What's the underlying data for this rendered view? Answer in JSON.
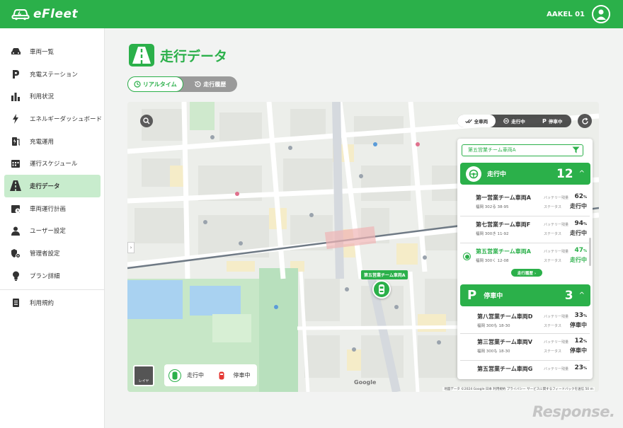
{
  "header": {
    "app_name": "eFleet",
    "user_name": "AAKEL 01",
    "brand_color": "#2bb04a"
  },
  "sidebar": {
    "items": [
      {
        "label": "車両一覧",
        "icon": "car-icon"
      },
      {
        "label": "充電ステーション",
        "icon": "parking-icon"
      },
      {
        "label": "利用状況",
        "icon": "bar-chart-icon"
      },
      {
        "label": "エネルギーダッシュボード",
        "icon": "lightning-icon"
      },
      {
        "label": "充電運用",
        "icon": "charger-icon"
      },
      {
        "label": "運行スケジュール",
        "icon": "calendar-icon"
      },
      {
        "label": "走行データ",
        "icon": "road-icon",
        "active": true
      },
      {
        "label": "車両運行計画",
        "icon": "calendar-plan-icon"
      },
      {
        "label": "ユーザー設定",
        "icon": "user-icon"
      },
      {
        "label": "管理者設定",
        "icon": "admin-settings-icon"
      },
      {
        "label": "プラン詳細",
        "icon": "bulb-icon"
      },
      {
        "label": "利用規約",
        "icon": "document-icon"
      }
    ]
  },
  "page": {
    "title": "走行データ",
    "toggle": {
      "realtime": "リアルタイム",
      "history": "走行履歴"
    }
  },
  "map": {
    "filters": {
      "all": "全車両",
      "driving": "走行中",
      "parked": "停車中"
    },
    "legend": {
      "driving": "走行中",
      "parked": "停車中",
      "layer": "レイヤ"
    },
    "pin_label": "第五営業チーム車両A",
    "google": "Google",
    "attribution": "地図データ ©2024 Google  日本  利用規約  プライバシー  サービスに関するフィードバックを送信  50 m"
  },
  "panel": {
    "search_value": "第五営業チーム車両A",
    "driving": {
      "label": "走行中",
      "count": "12",
      "vehicles": [
        {
          "name": "第一営業チーム車両A",
          "plate": "福岡 302る 38-95",
          "battery_label": "バッテリー残量",
          "battery": "62",
          "status_label": "ステータス",
          "status": "走行中"
        },
        {
          "name": "第七営業チーム車両F",
          "plate": "福岡 300き 11-92",
          "battery_label": "バッテリー残量",
          "battery": "94",
          "status_label": "ステータス",
          "status": "走行中"
        },
        {
          "name": "第五営業チーム車両A",
          "plate": "福岡 300く 12-08",
          "battery_label": "バッテリー残量",
          "battery": "47",
          "status_label": "ステータス",
          "status": "走行中",
          "history_button": "走行履歴 ›"
        }
      ]
    },
    "parked": {
      "label": "停車中",
      "count": "3",
      "vehicles": [
        {
          "name": "第八営業チーム車両D",
          "plate": "福岡 300も 18-30",
          "battery_label": "バッテリー残量",
          "battery": "33",
          "status_label": "ステータス",
          "status": "停車中"
        },
        {
          "name": "第三営業チーム車両V",
          "plate": "福岡 300も 18-30",
          "battery_label": "バッテリー残量",
          "battery": "12",
          "status_label": "ステータス",
          "status": "停車中"
        },
        {
          "name": "第五営業チーム車両G",
          "plate": "",
          "battery_label": "バッテリー残量",
          "battery": "23",
          "status_label": "",
          "status": ""
        }
      ]
    },
    "percent_unit": "%"
  },
  "watermark": "Response."
}
